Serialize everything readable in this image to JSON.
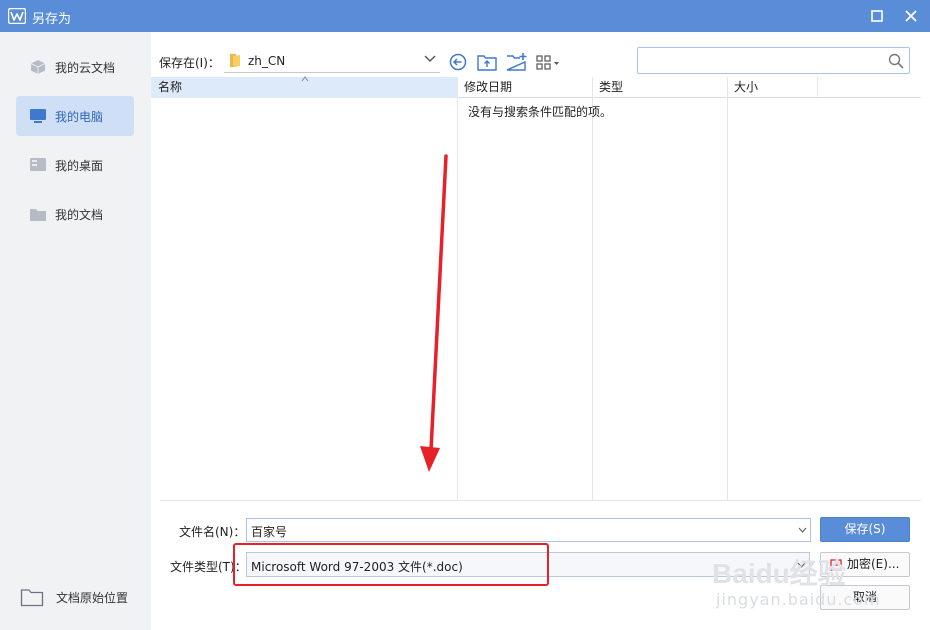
{
  "window": {
    "title": "另存为"
  },
  "sidebar": {
    "items": [
      {
        "label": "我的云文档",
        "icon": "cloud-doc-icon"
      },
      {
        "label": "我的电脑",
        "icon": "computer-icon"
      },
      {
        "label": "我的桌面",
        "icon": "desktop-icon"
      },
      {
        "label": "我的文档",
        "icon": "folder-icon"
      }
    ],
    "active_index": 1,
    "original_location_label": "文档原始位置"
  },
  "toolbar": {
    "save_in_label": "保存在(I)：",
    "path": "zh_CN"
  },
  "file_list": {
    "columns": [
      "名称",
      "修改日期",
      "类型",
      "大小"
    ],
    "empty_message": "没有与搜索条件匹配的项。"
  },
  "form": {
    "filename_label": "文件名(N)：",
    "filename_value": "百家号",
    "filetype_label": "文件类型(T)：",
    "filetype_value": "Microsoft Word 97-2003 文件(*.doc)"
  },
  "buttons": {
    "save": "保存(S)",
    "encrypt": "加密(E)...",
    "cancel": "取消"
  },
  "watermark": {
    "brand": "Baidu经验",
    "url": "jingyan.baidu.com"
  },
  "colors": {
    "accent": "#5a8dd8",
    "annotation_red": "#e6212a",
    "active_bg": "#cfdff5"
  }
}
